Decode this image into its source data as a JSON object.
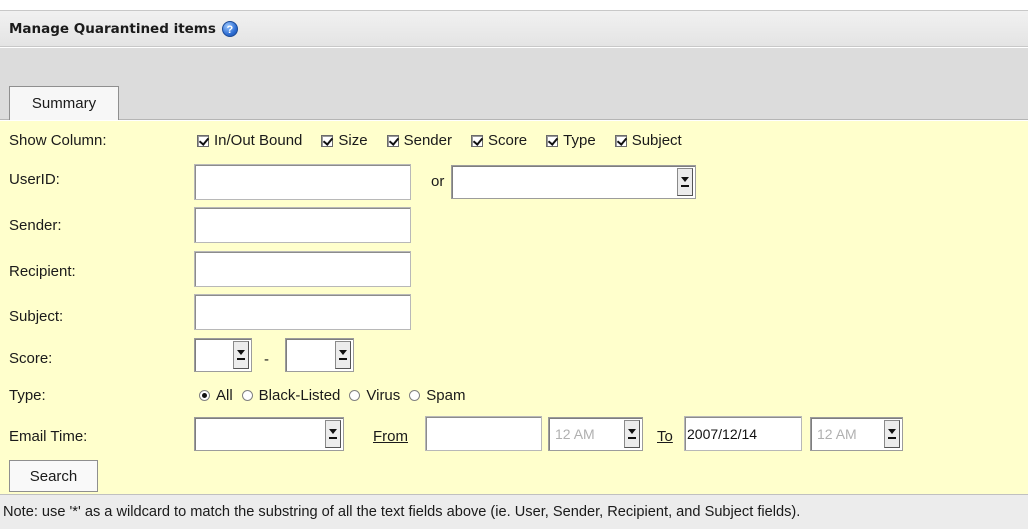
{
  "title": "Manage Quarantined items",
  "tab_summary": "Summary",
  "show_column": {
    "label": "Show Column:",
    "options": [
      {
        "label": "In/Out Bound",
        "checked": true
      },
      {
        "label": "Size",
        "checked": true
      },
      {
        "label": "Sender",
        "checked": true
      },
      {
        "label": "Score",
        "checked": true
      },
      {
        "label": "Type",
        "checked": true
      },
      {
        "label": "Subject",
        "checked": true
      }
    ]
  },
  "fields": {
    "userid_label": "UserID:",
    "or_label": "or",
    "sender_label": "Sender:",
    "recipient_label": "Recipient:",
    "subject_label": "Subject:",
    "score_label": "Score:",
    "score_dash": "-",
    "type_label": "Type:",
    "email_time_label": "Email Time:"
  },
  "type_options": [
    {
      "label": "All",
      "selected": true
    },
    {
      "label": "Black-Listed",
      "selected": false
    },
    {
      "label": "Virus",
      "selected": false
    },
    {
      "label": "Spam",
      "selected": false
    }
  ],
  "email_time": {
    "from_label": "From",
    "from_date": "",
    "from_hour": "12 AM",
    "to_label": "To",
    "to_date": "2007/12/14",
    "to_hour": "12 AM"
  },
  "search_label": "Search",
  "note": "Note: use '*' as a wildcard to match the substring of all the text fields above (ie. User, Sender, Recipient, and Subject fields)."
}
